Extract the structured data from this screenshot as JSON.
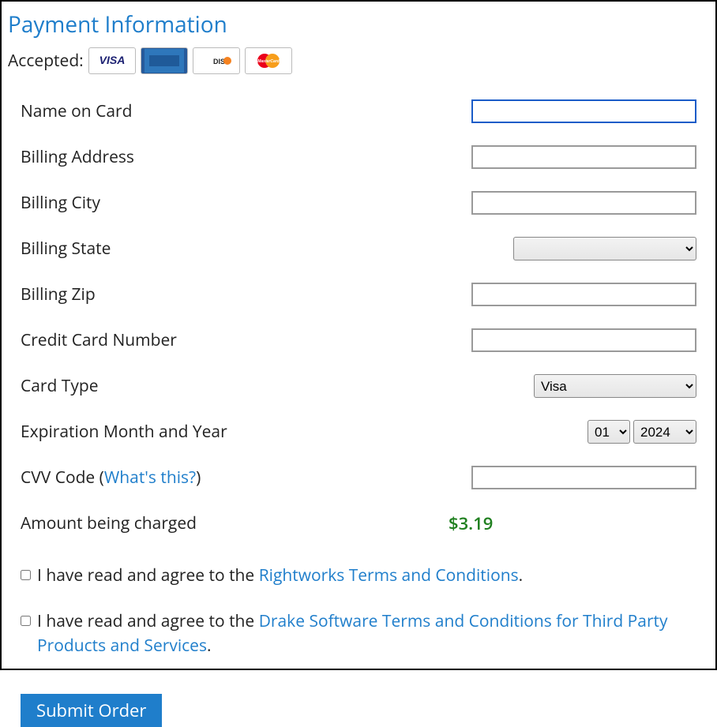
{
  "title": "Payment Information",
  "accepted_label": "Accepted:",
  "card_icons": {
    "visa": "VISA",
    "amex": "AMERICAN EXPRESS",
    "discover": "DISCOVER",
    "mastercard": "MasterCard"
  },
  "labels": {
    "name_on_card": "Name on Card",
    "billing_address": "Billing Address",
    "billing_city": "Billing City",
    "billing_state": "Billing State",
    "billing_zip": "Billing Zip",
    "cc_number": "Credit Card Number",
    "card_type": "Card Type",
    "exp": "Expiration Month and Year",
    "cvv_code": "CVV Code  (",
    "cvv_link": "What's this?",
    "cvv_close": ")",
    "amount": "Amount being charged"
  },
  "values": {
    "name_on_card": "",
    "billing_address": "",
    "billing_city": "",
    "billing_state": "",
    "billing_zip": "",
    "cc_number": "",
    "card_type": "Visa",
    "exp_month": "01",
    "exp_year": "2024",
    "cvv": "",
    "amount": "$3.19"
  },
  "terms": {
    "prefix": " I have read and agree to the ",
    "rightworks_link": "Rightworks Terms and Conditions",
    "period": ".",
    "drake_link": "Drake Software Terms and Conditions for Third Party Products and Services"
  },
  "submit_label": "Submit Order"
}
